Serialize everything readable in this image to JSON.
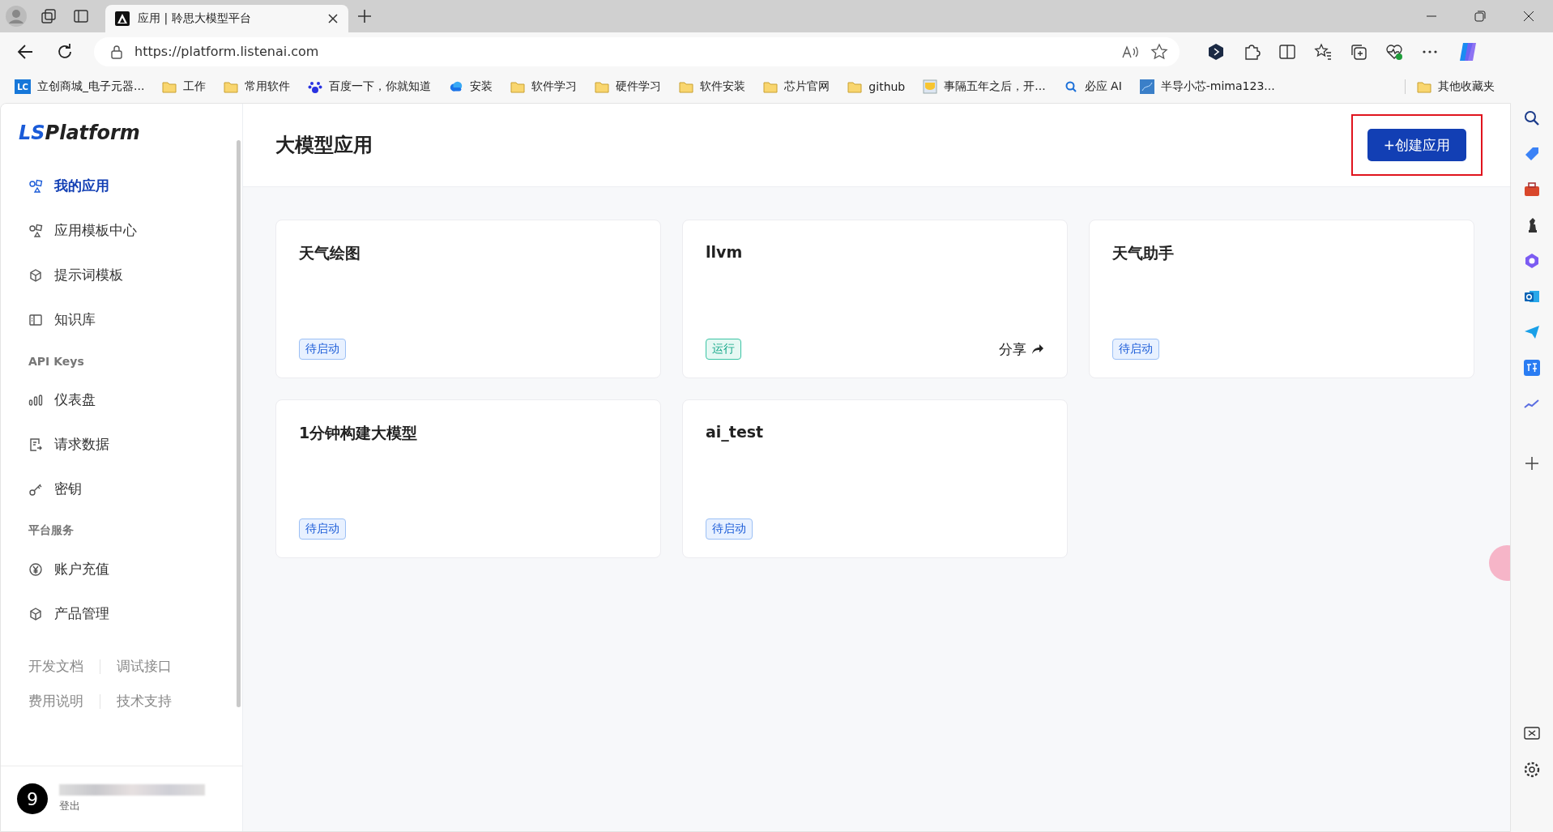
{
  "browser": {
    "tab": {
      "title": "应用 | 聆思大模型平台"
    },
    "url": "https://platform.listenai.com",
    "bookmarks": [
      {
        "label": "立创商城_电子元器...",
        "kind": "lc",
        "icon_text": "LC"
      },
      {
        "label": "工作",
        "kind": "folder"
      },
      {
        "label": "常用软件",
        "kind": "folder"
      },
      {
        "label": "百度一下，你就知道",
        "kind": "paw"
      },
      {
        "label": "安装",
        "kind": "cloud"
      },
      {
        "label": "软件学习",
        "kind": "folder"
      },
      {
        "label": "硬件学习",
        "kind": "folder"
      },
      {
        "label": "软件安装",
        "kind": "folder"
      },
      {
        "label": "芯片官网",
        "kind": "folder"
      },
      {
        "label": "github",
        "kind": "folder"
      },
      {
        "label": "事隔五年之后，开...",
        "kind": "image"
      },
      {
        "label": "必应 AI",
        "kind": "search"
      },
      {
        "label": "半导小芯-mima123...",
        "kind": "site"
      }
    ],
    "other_bookmarks": {
      "label": "其他收藏夹"
    }
  },
  "sidebar": {
    "logo": {
      "prefix": "LS",
      "suffix": "Platform"
    },
    "sections": [
      {
        "items": [
          {
            "label": "我的应用",
            "kind": "shapes",
            "selected": true
          },
          {
            "label": "应用模板中心",
            "kind": "shapes",
            "selected": false
          },
          {
            "label": "提示词模板",
            "kind": "cube",
            "selected": false
          },
          {
            "label": "知识库",
            "kind": "book",
            "selected": false
          }
        ]
      },
      {
        "heading": "API Keys",
        "items": [
          {
            "label": "仪表盘",
            "kind": "bars",
            "selected": false
          },
          {
            "label": "请求数据",
            "kind": "doc",
            "selected": false
          },
          {
            "label": "密钥",
            "kind": "key",
            "selected": false
          }
        ]
      },
      {
        "heading": "平台服务",
        "items": [
          {
            "label": "账户充值",
            "kind": "yen",
            "selected": false
          },
          {
            "label": "产品管理",
            "kind": "cube",
            "selected": false
          }
        ]
      }
    ],
    "footer_links": [
      [
        "开发文档",
        "调试接口"
      ],
      [
        "费用说明",
        "技术支持"
      ]
    ],
    "user": {
      "avatar": "9",
      "logout": "登出"
    }
  },
  "header": {
    "title": "大模型应用",
    "create_button": "+创建应用",
    "highlighted": true
  },
  "apps": [
    {
      "name": "天气绘图",
      "status": "待启动",
      "kind": "idle"
    },
    {
      "name": "llvm",
      "status": "运行",
      "kind": "running",
      "share": "分享"
    },
    {
      "name": "天气助手",
      "status": "待启动",
      "kind": "idle"
    },
    {
      "name": "1分钟构建大模型",
      "status": "待启动",
      "kind": "idle"
    },
    {
      "name": "ai_test",
      "status": "待启动",
      "kind": "idle"
    }
  ]
}
